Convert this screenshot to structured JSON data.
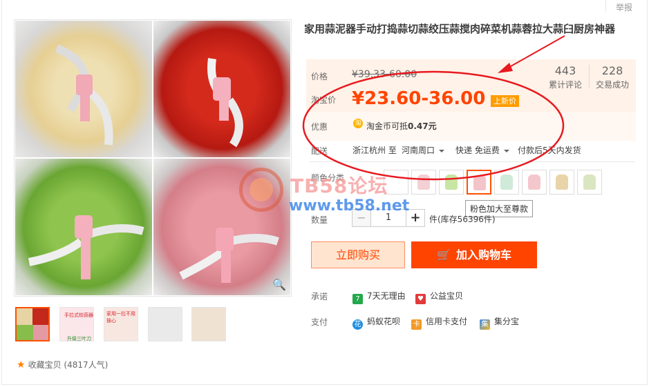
{
  "report_link": "举报",
  "title": "家用蒜泥器手动打捣蒜切蒜绞压蒜搅肉碎菜机蒜蓉拉大蒜臼厨房神器",
  "price": {
    "label": "价格",
    "old": "¥39.33-60.00",
    "tb_label": "淘宝价",
    "current": "¥23.60-36.00",
    "new_tag": "上新价"
  },
  "stats": {
    "reviews_count": "443",
    "reviews_label": "累计评论",
    "sold_count": "228",
    "sold_label": "交易成功"
  },
  "promo": {
    "label": "优惠",
    "coin_icon": "淘",
    "text_prefix": "淘金币可抵",
    "amount": "0.47元"
  },
  "shipping": {
    "label": "配送",
    "from": "浙江杭州 至",
    "to": "河南周口",
    "method": "快递 免运费",
    "dispatch": "付款后5天内发货"
  },
  "color": {
    "label": "颜色分类",
    "swatch_colors": [
      "#fff",
      "#f2d0d4",
      "#c7e6a3",
      "#f3c4c9",
      "#cfead8",
      "#f4c7cd",
      "#e9d3a8",
      "#d9e6c0"
    ],
    "tooltip": "粉色加大至尊款"
  },
  "quantity": {
    "label": "数量",
    "dec": "−",
    "value": "1",
    "inc": "+",
    "stock": "件(库存56396件)"
  },
  "buttons": {
    "buy": "立即购买",
    "cart": "加入购物车",
    "cart_icon": "🛒"
  },
  "promise": {
    "label": "承诺",
    "item1_icon": "7",
    "item1": "7天无理由",
    "item2_icon": "♥",
    "item2": "公益宝贝"
  },
  "payment": {
    "label": "支付",
    "item1_icon": "花",
    "item1": "蚂蚁花呗",
    "item2_icon": "卡",
    "item2": "信用卡支付",
    "item3_icon": "集",
    "item3": "集分宝"
  },
  "favorite": {
    "icon": "★",
    "text": "收藏宝贝",
    "count": "(4817人气)"
  },
  "thumb_texts": {
    "t2a": "手拉式绞蒜器",
    "t2b": "升级三叶刀片",
    "t3": "家用一拉不用操心"
  },
  "zoom_icon": "🔍",
  "watermark": {
    "line1": "TB58论坛",
    "line2": "www.tb58.net"
  },
  "colors": {
    "accent": "#ff4400",
    "annotation": "#e8191f"
  }
}
